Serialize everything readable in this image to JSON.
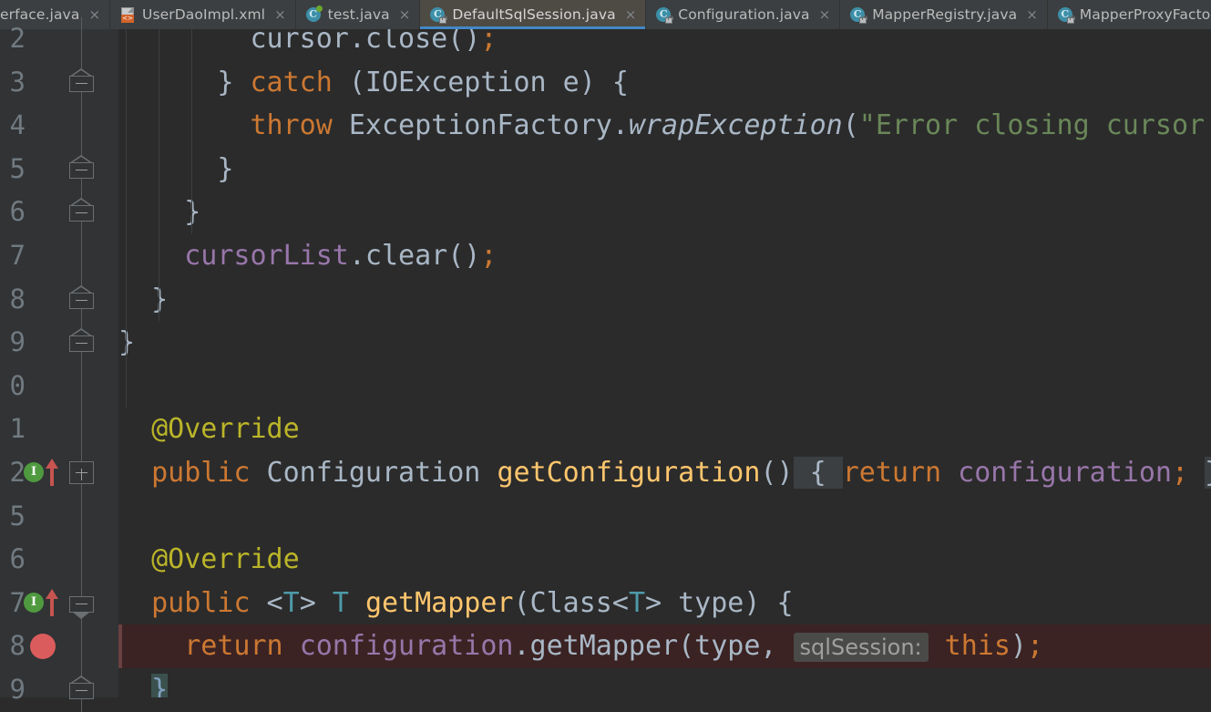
{
  "tabs": [
    {
      "label": "erface.java",
      "icon": "java-class-icon",
      "active": false,
      "close": "×",
      "truncated_left": true
    },
    {
      "label": "UserDaoImpl.xml",
      "icon": "xml-file-icon",
      "active": false,
      "close": "×"
    },
    {
      "label": "test.java",
      "icon": "java-test-class-icon",
      "active": false,
      "close": "×"
    },
    {
      "label": "DefaultSqlSession.java",
      "icon": "java-class-icon",
      "active": true,
      "close": "×"
    },
    {
      "label": "Configuration.java",
      "icon": "java-class-icon",
      "active": false,
      "close": "×"
    },
    {
      "label": "MapperRegistry.java",
      "icon": "java-class-icon",
      "active": false,
      "close": "×"
    },
    {
      "label": "MapperProxyFactory.java",
      "icon": "java-class-icon",
      "active": false,
      "close": "×"
    },
    {
      "label": "",
      "icon": "java-class-icon",
      "active": false,
      "close": "×",
      "truncated_right": true
    }
  ],
  "editor": {
    "file": "DefaultSqlSession.java",
    "language": "java",
    "theme": "darcula",
    "accent_color": "#4387c7",
    "background": "#2b2b2b",
    "gutter_background": "#313335",
    "execution_line_background": "#3b2323",
    "lines": [
      {
        "num": "2",
        "text": "        cursor.close();",
        "partial_top": true,
        "tokens": [
          {
            "t": "        cursor",
            "c": "plain"
          },
          {
            "t": ".close()",
            "c": "plain"
          },
          {
            "t": ";",
            "c": "kw"
          }
        ]
      },
      {
        "num": "3",
        "text": "      } catch (IOException e) {",
        "fold": "minus",
        "tokens": [
          {
            "t": "      } ",
            "c": "plain"
          },
          {
            "t": "catch",
            "c": "kw"
          },
          {
            "t": " (IOException e) {",
            "c": "plain"
          }
        ]
      },
      {
        "num": "4",
        "text": "        throw ExceptionFactory.wrapException(\"Error closing cursor",
        "tokens": [
          {
            "t": "        ",
            "c": "plain"
          },
          {
            "t": "throw",
            "c": "kw"
          },
          {
            "t": " ExceptionFactory.",
            "c": "plain"
          },
          {
            "t": "wrapException",
            "c": "plain-italic"
          },
          {
            "t": "(",
            "c": "plain"
          },
          {
            "t": "\"Error closing cursor",
            "c": "str"
          }
        ]
      },
      {
        "num": "5",
        "text": "      }",
        "fold": "minus",
        "tokens": [
          {
            "t": "      }",
            "c": "plain"
          }
        ]
      },
      {
        "num": "6",
        "text": "    }",
        "fold": "minus",
        "tokens": [
          {
            "t": "    }",
            "c": "plain"
          }
        ]
      },
      {
        "num": "7",
        "text": "    cursorList.clear();",
        "tokens": [
          {
            "t": "    ",
            "c": "plain"
          },
          {
            "t": "cursorList",
            "c": "fld"
          },
          {
            "t": ".clear()",
            "c": "plain"
          },
          {
            "t": ";",
            "c": "kw"
          }
        ]
      },
      {
        "num": "8",
        "text": "  }",
        "fold": "minus",
        "tokens": [
          {
            "t": "  }",
            "c": "plain"
          }
        ]
      },
      {
        "num": "9",
        "text": "}",
        "fold": "minus",
        "tokens": [
          {
            "t": "}",
            "c": "plain"
          }
        ]
      },
      {
        "num": "0",
        "text": "",
        "tokens": []
      },
      {
        "num": "1",
        "text": "  @Override",
        "tokens": [
          {
            "t": "  ",
            "c": "plain"
          },
          {
            "t": "@Override",
            "c": "ann"
          }
        ]
      },
      {
        "num": "2",
        "text": "  public Configuration getConfiguration() { return configuration; }",
        "gutter_icons": [
          "implementing-method-icon",
          "up-arrow-icon"
        ],
        "fold": "plus",
        "tokens": [
          {
            "t": "  ",
            "c": "plain"
          },
          {
            "t": "public",
            "c": "kw"
          },
          {
            "t": " Configuration ",
            "c": "cls"
          },
          {
            "t": "getConfiguration",
            "c": "fn"
          },
          {
            "t": "()",
            "c": "plain"
          },
          {
            "t": " { ",
            "c": "foldpill"
          },
          {
            "t": "return",
            "c": "kw"
          },
          {
            "t": " ",
            "c": "plain"
          },
          {
            "t": "configuration",
            "c": "fld"
          },
          {
            "t": "; ",
            "c": "kw"
          },
          {
            "t": "}",
            "c": "foldpill"
          }
        ]
      },
      {
        "num": "5",
        "text": "",
        "tokens": []
      },
      {
        "num": "6",
        "text": "  @Override",
        "tokens": [
          {
            "t": "  ",
            "c": "plain"
          },
          {
            "t": "@Override",
            "c": "ann"
          }
        ]
      },
      {
        "num": "7",
        "text": "  public <T> T getMapper(Class<T> type) {",
        "gutter_icons": [
          "implementing-method-icon",
          "up-arrow-icon"
        ],
        "fold": "minus-down",
        "tokens": [
          {
            "t": "  ",
            "c": "plain"
          },
          {
            "t": "public",
            "c": "kw"
          },
          {
            "t": " <",
            "c": "plain"
          },
          {
            "t": "T",
            "c": "gen"
          },
          {
            "t": "> ",
            "c": "plain"
          },
          {
            "t": "T",
            "c": "gen"
          },
          {
            "t": " ",
            "c": "plain"
          },
          {
            "t": "getMapper",
            "c": "fn"
          },
          {
            "t": "(Class<",
            "c": "plain"
          },
          {
            "t": "T",
            "c": "gen"
          },
          {
            "t": "> type) {",
            "c": "plain"
          }
        ]
      },
      {
        "num": "8",
        "text": "    return configuration.getMapper(type,  sqlSession: this);",
        "gutter_icons": [
          "breakpoint-icon"
        ],
        "execution_line": true,
        "tokens": [
          {
            "t": "    ",
            "c": "plain"
          },
          {
            "t": "return",
            "c": "kw"
          },
          {
            "t": " ",
            "c": "plain"
          },
          {
            "t": "configuration",
            "c": "fld"
          },
          {
            "t": ".getMapper(type, ",
            "c": "plain"
          },
          {
            "t": "sqlSession:",
            "c": "hint"
          },
          {
            "t": " ",
            "c": "plain"
          },
          {
            "t": "this",
            "c": "kw"
          },
          {
            "t": ")",
            "c": "plain"
          },
          {
            "t": ";",
            "c": "kw"
          }
        ]
      },
      {
        "num": "9",
        "text": "  }",
        "fold": "minus",
        "tokens": [
          {
            "t": "  ",
            "c": "plain"
          },
          {
            "t": "}",
            "c": "matchbrace"
          }
        ]
      }
    ]
  }
}
